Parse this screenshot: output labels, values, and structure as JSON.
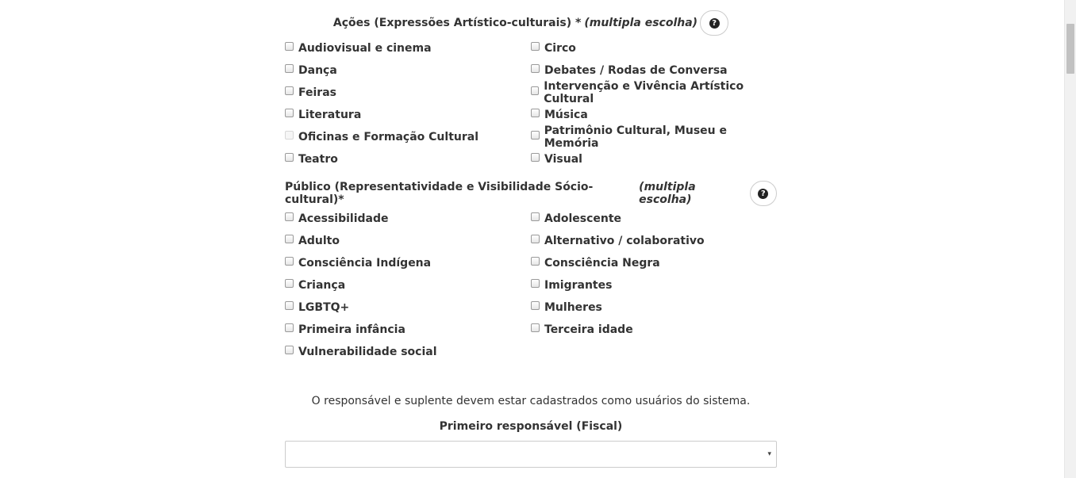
{
  "acoes": {
    "title": "Ações (Expressões Artístico-culturais) *",
    "title_em": "(multipla escolha)",
    "help_icon": "question-circle-icon",
    "options": [
      {
        "label": "Audiovisual e cinema"
      },
      {
        "label": "Circo"
      },
      {
        "label": "Dança"
      },
      {
        "label": "Debates / Rodas de Conversa"
      },
      {
        "label": "Feiras"
      },
      {
        "label": "Intervenção e Vivência Artístico Cultural"
      },
      {
        "label": "Literatura"
      },
      {
        "label": "Música"
      },
      {
        "label": "Oficinas e Formação Cultural",
        "disabled": true
      },
      {
        "label": "Patrimônio Cultural, Museu e Memória"
      },
      {
        "label": "Teatro"
      },
      {
        "label": "Visual"
      }
    ]
  },
  "publico": {
    "title": "Público (Representatividade e Visibilidade Sócio-cultural)*",
    "title_em": "(multipla escolha)",
    "help_icon": "question-circle-icon",
    "options": [
      {
        "label": "Acessibilidade"
      },
      {
        "label": "Adolescente"
      },
      {
        "label": "Adulto"
      },
      {
        "label": "Alternativo / colaborativo"
      },
      {
        "label": "Consciência Indígena"
      },
      {
        "label": "Consciência Negra"
      },
      {
        "label": "Criança"
      },
      {
        "label": "Imigrantes"
      },
      {
        "label": "LGBTQ+"
      },
      {
        "label": "Mulheres"
      },
      {
        "label": "Primeira infância"
      },
      {
        "label": "Terceira idade"
      },
      {
        "label": "Vulnerabilidade social"
      }
    ]
  },
  "responsavel": {
    "note": "O responsável e suplente devem estar cadastrados como usuários do sistema.",
    "label": "Primeiro responsável (Fiscal)",
    "selected": "",
    "arrow": "▾"
  }
}
